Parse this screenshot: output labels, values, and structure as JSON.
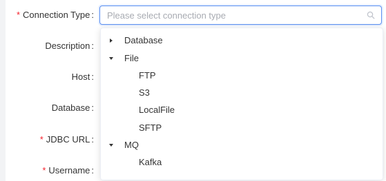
{
  "form": {
    "connection_type": {
      "label": "Connection Type",
      "required": true,
      "placeholder": "Please select connection type"
    },
    "description": {
      "label": "Description",
      "required": false
    },
    "host": {
      "label": "Host",
      "required": false
    },
    "database": {
      "label": "Database",
      "required": false
    },
    "jdbc_url": {
      "label": "JDBC URL",
      "required": true
    },
    "username": {
      "label": "Username",
      "required": true
    },
    "required_mark": "*",
    "colon": ":"
  },
  "dropdown": {
    "groups": [
      {
        "label": "Database",
        "expanded": false,
        "children": []
      },
      {
        "label": "File",
        "expanded": true,
        "children": [
          "FTP",
          "S3",
          "LocalFile",
          "SFTP"
        ]
      },
      {
        "label": "MQ",
        "expanded": true,
        "children": [
          "Kafka"
        ]
      }
    ]
  },
  "icons": {
    "search": "search-icon",
    "collapsed": "caret-right-icon",
    "expanded": "caret-down-icon"
  },
  "colors": {
    "required": "#f5222d",
    "focus_border": "#5a8ff0",
    "placeholder": "#a8abb2"
  }
}
